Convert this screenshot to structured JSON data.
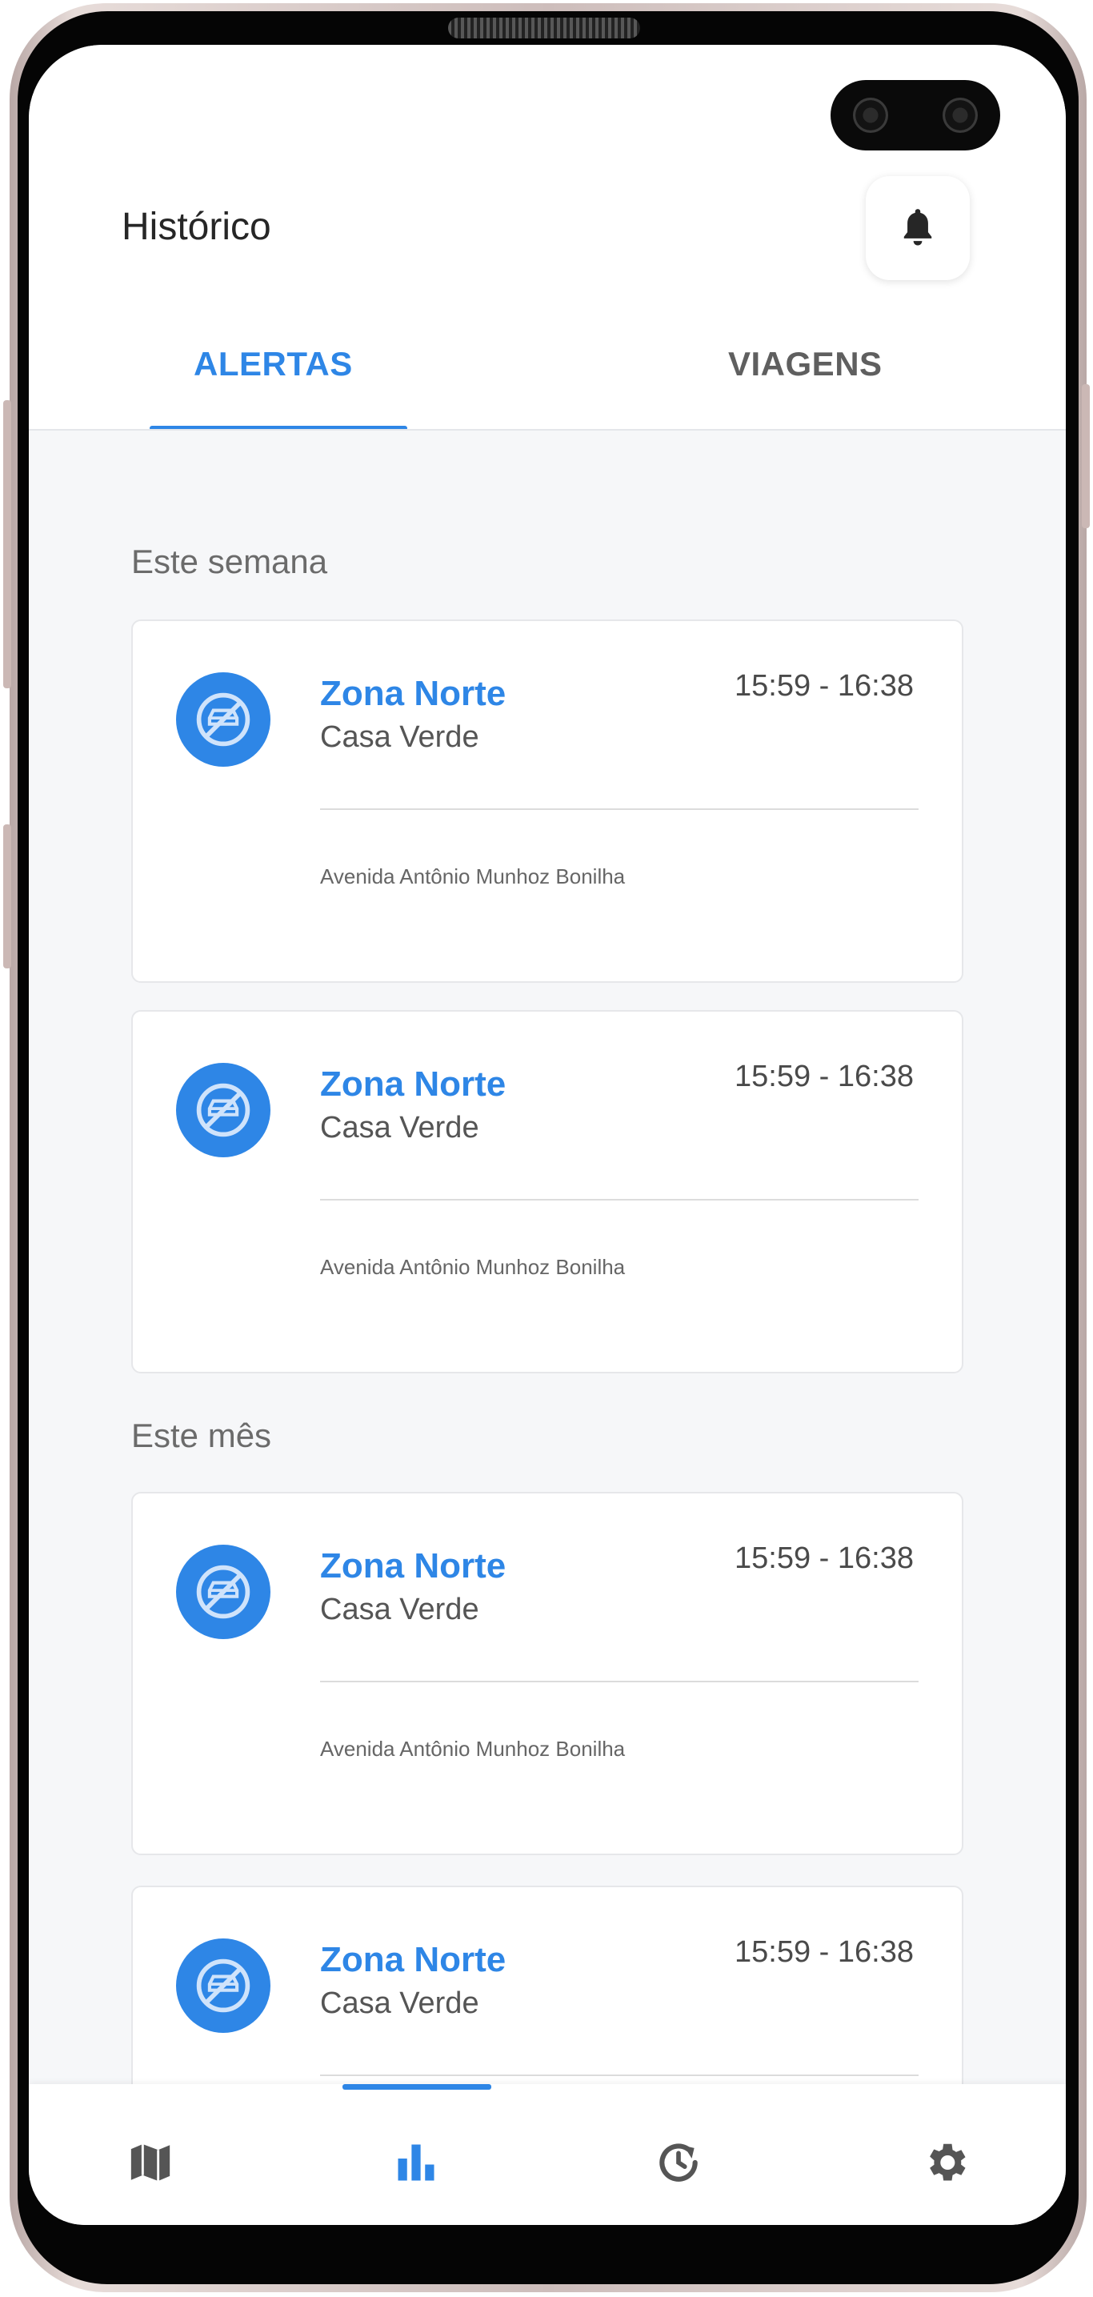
{
  "header": {
    "title": "Histórico",
    "notification_icon": "bell-icon"
  },
  "tabs": [
    {
      "label": "ALERTAS",
      "active": true
    },
    {
      "label": "VIAGENS",
      "active": false
    }
  ],
  "sections": [
    {
      "title": "Este semana",
      "alerts": [
        {
          "icon": "no-car-icon",
          "zone": "Zona Norte",
          "district": "Casa Verde",
          "time": "15:59 - 16:38",
          "address": "Avenida Antônio Munhoz Bonilha"
        },
        {
          "icon": "no-car-icon",
          "zone": "Zona Norte",
          "district": "Casa Verde",
          "time": "15:59 - 16:38",
          "address": "Avenida Antônio Munhoz Bonilha"
        }
      ]
    },
    {
      "title": "Este mês",
      "alerts": [
        {
          "icon": "no-car-icon",
          "zone": "Zona Norte",
          "district": "Casa Verde",
          "time": "15:59 - 16:38",
          "address": "Avenida Antônio Munhoz Bonilha"
        },
        {
          "icon": "no-car-icon",
          "zone": "Zona Norte",
          "district": "Casa Verde",
          "time": "15:59 - 16:38",
          "address": ""
        }
      ]
    }
  ],
  "bottom_nav": [
    {
      "icon": "map-icon",
      "active": false
    },
    {
      "icon": "bar-chart-icon",
      "active": true
    },
    {
      "icon": "history-icon",
      "active": false
    },
    {
      "icon": "settings-icon",
      "active": false
    }
  ],
  "colors": {
    "accent": "#2e86e6",
    "background": "#f6f7f9",
    "card": "#ffffff",
    "text_muted": "#6b6b6b"
  }
}
